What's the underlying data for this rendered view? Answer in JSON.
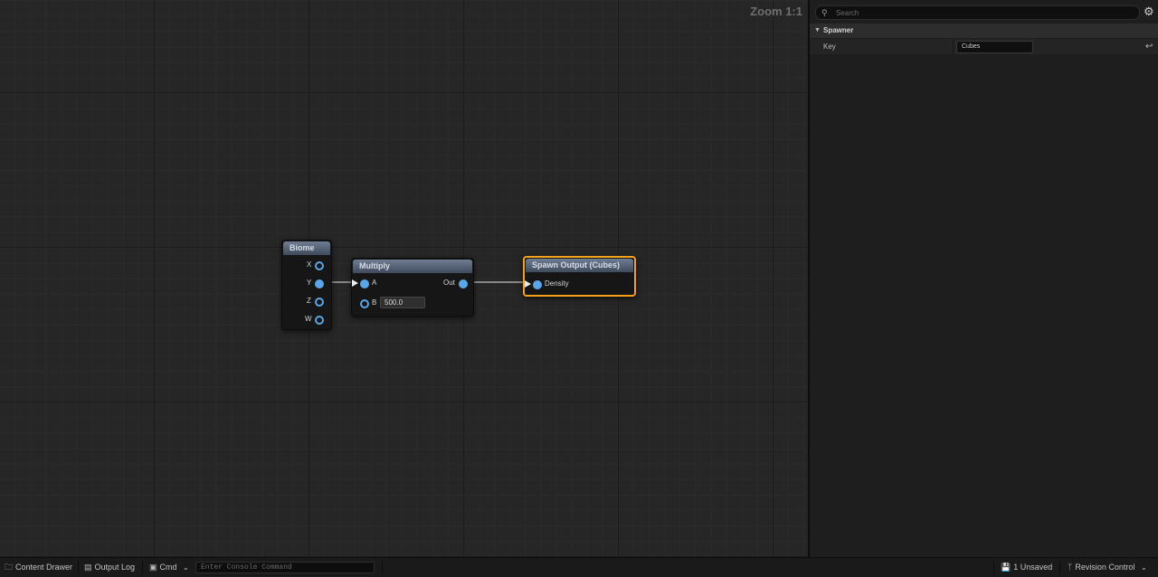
{
  "graph": {
    "zoom_label": "Zoom 1:1",
    "nodes": {
      "biome": {
        "title": "Biome",
        "pins": [
          "X",
          "Y",
          "Z",
          "W"
        ]
      },
      "multiply": {
        "title": "Multiply",
        "input_a": "A",
        "input_b": "B",
        "b_value": "500.0",
        "output": "Out"
      },
      "spawn_output": {
        "title": "Spawn Output (Cubes)",
        "input": "Density"
      }
    }
  },
  "details": {
    "search_placeholder": "Search",
    "settings_icon": "gear-icon",
    "category": "Spawner",
    "properties": [
      {
        "name": "Key",
        "value": "Cubes"
      }
    ]
  },
  "statusbar": {
    "content_drawer": "Content Drawer",
    "output_log": "Output Log",
    "cmd": "Cmd",
    "console_placeholder": "Enter Console Command",
    "unsaved": "1 Unsaved",
    "revision_control": "Revision Control"
  },
  "colors": {
    "selected_node_border": "#f5a21a",
    "pin_color": "#5aa6e8",
    "node_header": "#5a6679"
  }
}
